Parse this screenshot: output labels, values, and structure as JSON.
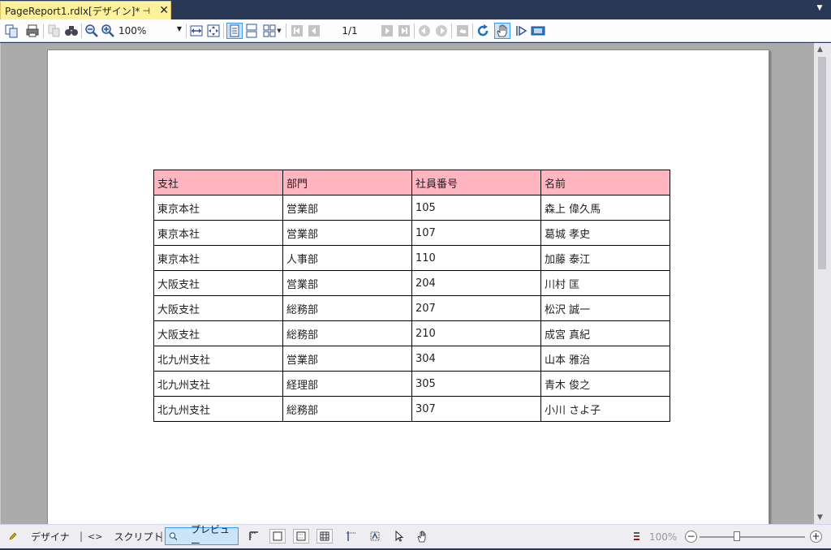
{
  "document_tab": {
    "title": "PageReport1.rdlx[デザイン]*",
    "pin_glyph": "⊣",
    "close_glyph": "✕"
  },
  "toolbar": {
    "zoom_value": "100%",
    "page_indicator": "1/1",
    "icons": [
      "copy-icon",
      "print-icon",
      "print-preview-icon",
      "find-icon",
      "zoom-out-icon",
      "zoom-in-icon",
      "fit-width-icon",
      "fit-page-icon",
      "single-page-icon",
      "continuous-page-icon",
      "multipage-icon",
      "first-page-icon",
      "previous-page-icon",
      "next-page-icon",
      "last-page-icon",
      "back-icon",
      "forward-icon",
      "cancel-icon",
      "refresh-icon",
      "pan-icon",
      "annotation-icon",
      "galley-icon"
    ]
  },
  "report": {
    "headers": [
      "支社",
      "部門",
      "社員番号",
      "名前"
    ],
    "header_color": "#ffb6c1",
    "rows": [
      [
        "東京本社",
        "営業部",
        "105",
        "森上 偉久馬"
      ],
      [
        "東京本社",
        "営業部",
        "107",
        "葛城 孝史"
      ],
      [
        "東京本社",
        "人事部",
        "110",
        "加藤 泰江"
      ],
      [
        "大阪支社",
        "営業部",
        "204",
        "川村 匡"
      ],
      [
        "大阪支社",
        "総務部",
        "207",
        "松沢 誠一"
      ],
      [
        "大阪支社",
        "総務部",
        "210",
        "成宮 真紀"
      ],
      [
        "北九州支社",
        "営業部",
        "304",
        "山本 雅治"
      ],
      [
        "北九州支社",
        "経理部",
        "305",
        "青木 俊之"
      ],
      [
        "北九州支社",
        "総務部",
        "307",
        "小川 さよ子"
      ]
    ]
  },
  "bottom_bar": {
    "designer_label": "デザイナ",
    "script_label": "スクリプト",
    "preview_label": "プレビュー",
    "separator": "|",
    "script_glyph": "<>",
    "zoom_readout": "100%",
    "zoom_fraction": 0.35,
    "minus": "−",
    "plus": "+"
  },
  "colors": {
    "tab_active": "#fff29d",
    "titlebar": "#293955",
    "selection": "#cce4f7",
    "selection_border": "#3399ff"
  }
}
